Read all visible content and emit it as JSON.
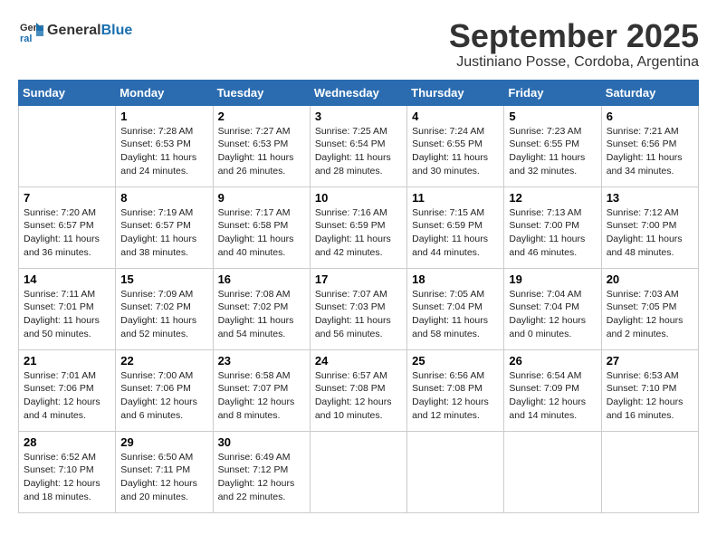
{
  "logo": {
    "general": "General",
    "blue": "Blue"
  },
  "title": "September 2025",
  "subtitle": "Justiniano Posse, Cordoba, Argentina",
  "weekdays": [
    "Sunday",
    "Monday",
    "Tuesday",
    "Wednesday",
    "Thursday",
    "Friday",
    "Saturday"
  ],
  "weeks": [
    [
      {
        "day": "",
        "info": ""
      },
      {
        "day": "1",
        "info": "Sunrise: 7:28 AM\nSunset: 6:53 PM\nDaylight: 11 hours\nand 24 minutes."
      },
      {
        "day": "2",
        "info": "Sunrise: 7:27 AM\nSunset: 6:53 PM\nDaylight: 11 hours\nand 26 minutes."
      },
      {
        "day": "3",
        "info": "Sunrise: 7:25 AM\nSunset: 6:54 PM\nDaylight: 11 hours\nand 28 minutes."
      },
      {
        "day": "4",
        "info": "Sunrise: 7:24 AM\nSunset: 6:55 PM\nDaylight: 11 hours\nand 30 minutes."
      },
      {
        "day": "5",
        "info": "Sunrise: 7:23 AM\nSunset: 6:55 PM\nDaylight: 11 hours\nand 32 minutes."
      },
      {
        "day": "6",
        "info": "Sunrise: 7:21 AM\nSunset: 6:56 PM\nDaylight: 11 hours\nand 34 minutes."
      }
    ],
    [
      {
        "day": "7",
        "info": "Sunrise: 7:20 AM\nSunset: 6:57 PM\nDaylight: 11 hours\nand 36 minutes."
      },
      {
        "day": "8",
        "info": "Sunrise: 7:19 AM\nSunset: 6:57 PM\nDaylight: 11 hours\nand 38 minutes."
      },
      {
        "day": "9",
        "info": "Sunrise: 7:17 AM\nSunset: 6:58 PM\nDaylight: 11 hours\nand 40 minutes."
      },
      {
        "day": "10",
        "info": "Sunrise: 7:16 AM\nSunset: 6:59 PM\nDaylight: 11 hours\nand 42 minutes."
      },
      {
        "day": "11",
        "info": "Sunrise: 7:15 AM\nSunset: 6:59 PM\nDaylight: 11 hours\nand 44 minutes."
      },
      {
        "day": "12",
        "info": "Sunrise: 7:13 AM\nSunset: 7:00 PM\nDaylight: 11 hours\nand 46 minutes."
      },
      {
        "day": "13",
        "info": "Sunrise: 7:12 AM\nSunset: 7:00 PM\nDaylight: 11 hours\nand 48 minutes."
      }
    ],
    [
      {
        "day": "14",
        "info": "Sunrise: 7:11 AM\nSunset: 7:01 PM\nDaylight: 11 hours\nand 50 minutes."
      },
      {
        "day": "15",
        "info": "Sunrise: 7:09 AM\nSunset: 7:02 PM\nDaylight: 11 hours\nand 52 minutes."
      },
      {
        "day": "16",
        "info": "Sunrise: 7:08 AM\nSunset: 7:02 PM\nDaylight: 11 hours\nand 54 minutes."
      },
      {
        "day": "17",
        "info": "Sunrise: 7:07 AM\nSunset: 7:03 PM\nDaylight: 11 hours\nand 56 minutes."
      },
      {
        "day": "18",
        "info": "Sunrise: 7:05 AM\nSunset: 7:04 PM\nDaylight: 11 hours\nand 58 minutes."
      },
      {
        "day": "19",
        "info": "Sunrise: 7:04 AM\nSunset: 7:04 PM\nDaylight: 12 hours\nand 0 minutes."
      },
      {
        "day": "20",
        "info": "Sunrise: 7:03 AM\nSunset: 7:05 PM\nDaylight: 12 hours\nand 2 minutes."
      }
    ],
    [
      {
        "day": "21",
        "info": "Sunrise: 7:01 AM\nSunset: 7:06 PM\nDaylight: 12 hours\nand 4 minutes."
      },
      {
        "day": "22",
        "info": "Sunrise: 7:00 AM\nSunset: 7:06 PM\nDaylight: 12 hours\nand 6 minutes."
      },
      {
        "day": "23",
        "info": "Sunrise: 6:58 AM\nSunset: 7:07 PM\nDaylight: 12 hours\nand 8 minutes."
      },
      {
        "day": "24",
        "info": "Sunrise: 6:57 AM\nSunset: 7:08 PM\nDaylight: 12 hours\nand 10 minutes."
      },
      {
        "day": "25",
        "info": "Sunrise: 6:56 AM\nSunset: 7:08 PM\nDaylight: 12 hours\nand 12 minutes."
      },
      {
        "day": "26",
        "info": "Sunrise: 6:54 AM\nSunset: 7:09 PM\nDaylight: 12 hours\nand 14 minutes."
      },
      {
        "day": "27",
        "info": "Sunrise: 6:53 AM\nSunset: 7:10 PM\nDaylight: 12 hours\nand 16 minutes."
      }
    ],
    [
      {
        "day": "28",
        "info": "Sunrise: 6:52 AM\nSunset: 7:10 PM\nDaylight: 12 hours\nand 18 minutes."
      },
      {
        "day": "29",
        "info": "Sunrise: 6:50 AM\nSunset: 7:11 PM\nDaylight: 12 hours\nand 20 minutes."
      },
      {
        "day": "30",
        "info": "Sunrise: 6:49 AM\nSunset: 7:12 PM\nDaylight: 12 hours\nand 22 minutes."
      },
      {
        "day": "",
        "info": ""
      },
      {
        "day": "",
        "info": ""
      },
      {
        "day": "",
        "info": ""
      },
      {
        "day": "",
        "info": ""
      }
    ]
  ]
}
